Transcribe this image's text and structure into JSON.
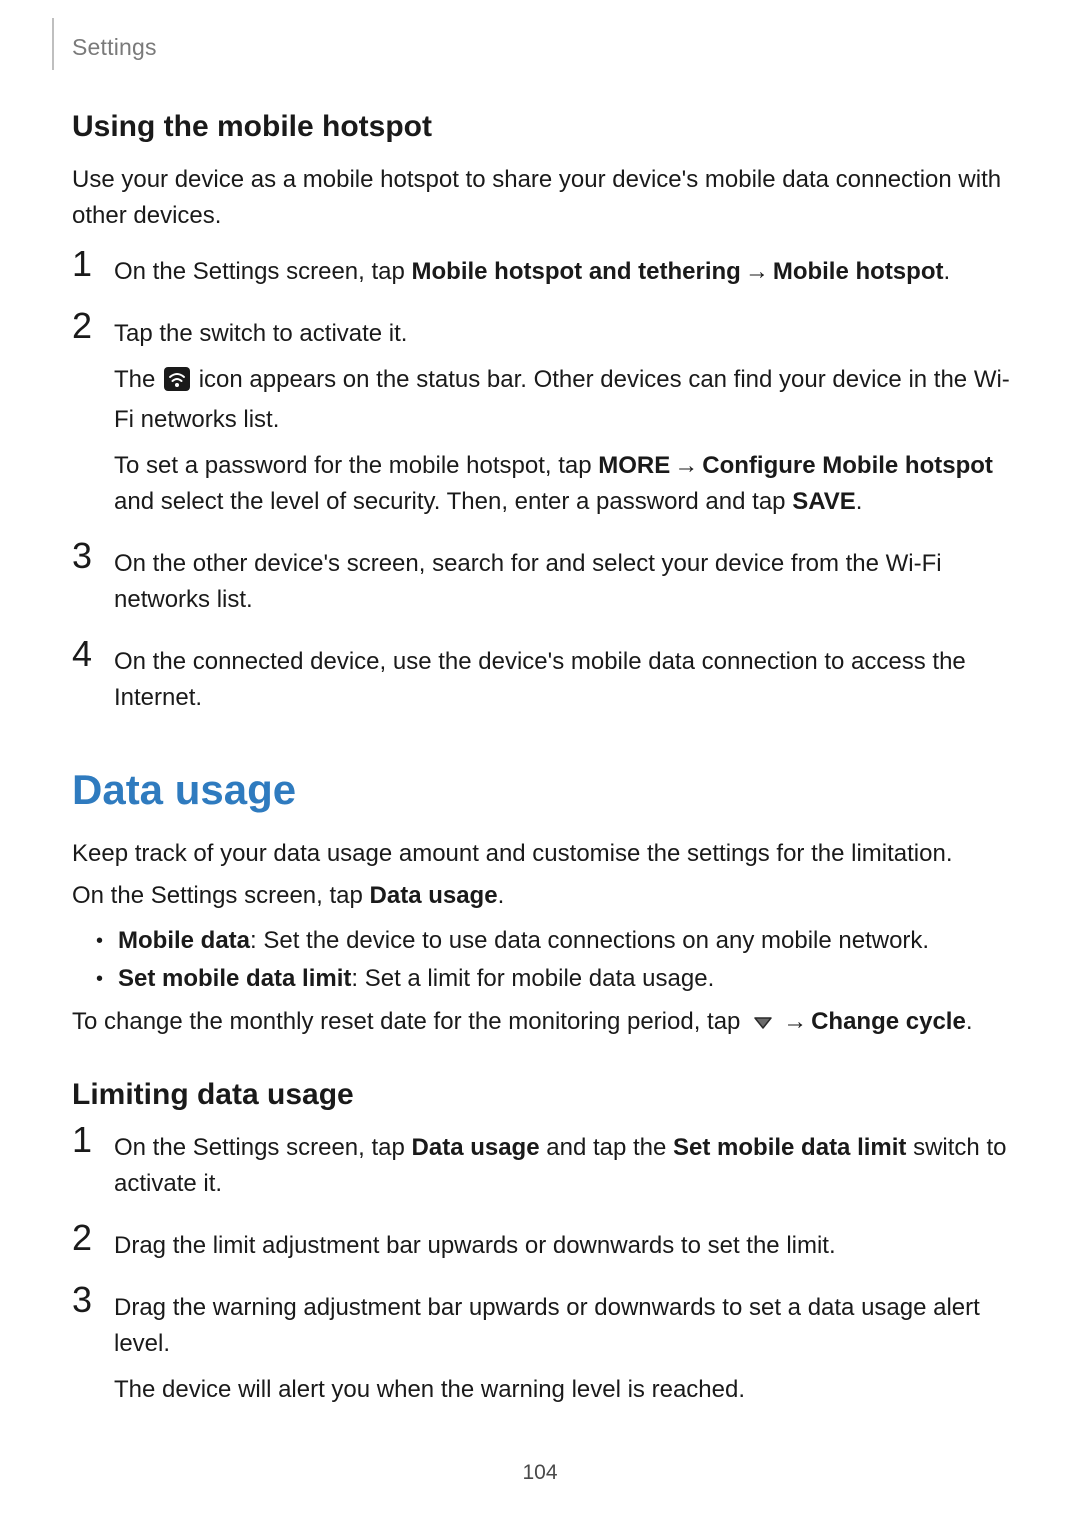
{
  "header": {
    "chapter": "Settings"
  },
  "page_number": "104",
  "arrow": "→",
  "hotspot": {
    "heading": "Using the mobile hotspot",
    "intro": "Use your device as a mobile hotspot to share your device's mobile data connection with other devices.",
    "step1_pre": "On the Settings screen, tap ",
    "step1_bold1": "Mobile hotspot and tethering",
    "step1_bold2": "Mobile hotspot",
    "step1_period": ".",
    "step2_line1": "Tap the switch to activate it.",
    "step2_note_pre": "The ",
    "step2_note_post": " icon appears on the status bar. Other devices can find your device in the Wi-Fi networks list.",
    "step2_pw_pre": "To set a password for the mobile hotspot, tap ",
    "step2_pw_more": "MORE",
    "step2_pw_conf": "Configure Mobile hotspot",
    "step2_pw_mid": " and select the level of security. Then, enter a password and tap ",
    "step2_pw_save": "SAVE",
    "step2_pw_period": ".",
    "step3": "On the other device's screen, search for and select your device from the Wi-Fi networks list.",
    "step4": "On the connected device, use the device's mobile data connection to access the Internet."
  },
  "datausage": {
    "title": "Data usage",
    "intro": "Keep track of your data usage amount and customise the settings for the limitation.",
    "nav_pre": "On the Settings screen, tap ",
    "nav_bold": "Data usage",
    "nav_period": ".",
    "bullet1_bold": "Mobile data",
    "bullet1_rest": ": Set the device to use data connections on any mobile network.",
    "bullet2_bold": "Set mobile data limit",
    "bullet2_rest": ": Set a limit for mobile data usage.",
    "cycle_pre": "To change the monthly reset date for the monitoring period, tap ",
    "cycle_bold": "Change cycle",
    "cycle_period": "."
  },
  "limiting": {
    "heading": "Limiting data usage",
    "step1_pre": "On the Settings screen, tap ",
    "step1_b1": "Data usage",
    "step1_mid": " and tap the ",
    "step1_b2": "Set mobile data limit",
    "step1_post": " switch to activate it.",
    "step2": "Drag the limit adjustment bar upwards or downwards to set the limit.",
    "step3_a": "Drag the warning adjustment bar upwards or downwards to set a data usage alert level.",
    "step3_b": "The device will alert you when the warning level is reached."
  }
}
